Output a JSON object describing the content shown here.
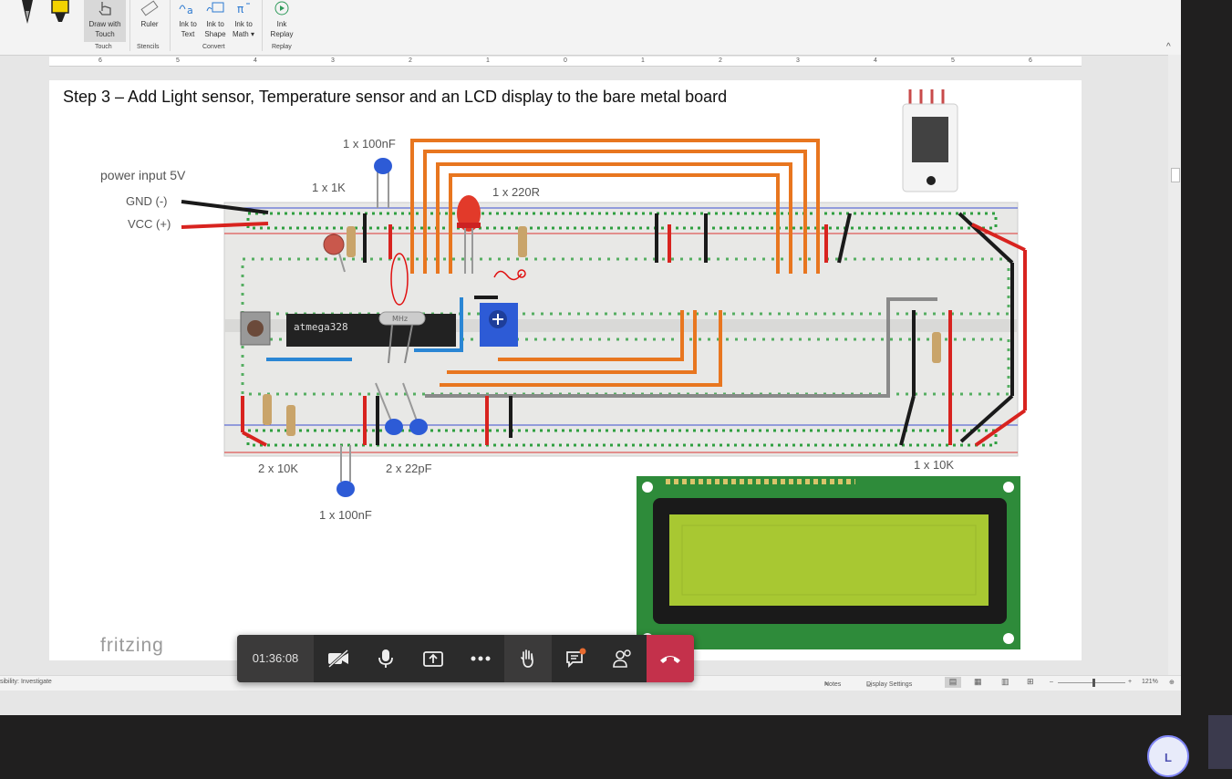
{
  "ribbon": {
    "buttons": [
      {
        "label": "Draw with Touch"
      },
      {
        "label": "Ruler"
      },
      {
        "label": "Ink to Text"
      },
      {
        "label": "Ink to Shape"
      },
      {
        "label": "Ink to Math"
      },
      {
        "label": "Ink Replay"
      }
    ],
    "groups": [
      "Touch",
      "Stencils",
      "Convert",
      "Replay"
    ]
  },
  "ruler": {
    "ticks": [
      "6",
      "5",
      "4",
      "3",
      "2",
      "1",
      "0",
      "1",
      "2",
      "3",
      "4",
      "5",
      "6"
    ]
  },
  "slide": {
    "title": "Step 3 – Add Light sensor, Temperature sensor and an LCD display to the bare metal board",
    "labels": {
      "cap_top": "1 x 100nF",
      "power_input": "power input 5V",
      "gnd": "GND (-)",
      "vcc": "VCC (+)",
      "r1k": "1 x 1K",
      "r220": "1 x 220R",
      "r10k_left": "2 x 10K",
      "caps22": "2 x 22pF",
      "cap_bottom": "1 x 100nF",
      "r10k_right": "1 x 10K",
      "chip": "atmega328",
      "crystal": "MHz"
    },
    "watermark": "fritzing"
  },
  "status": {
    "accessibility": "sibility: Investigate",
    "notes": "Notes",
    "display_settings": "Display Settings",
    "zoom": "121%"
  },
  "call": {
    "timer": "01:36:08",
    "buttons": [
      "camera-off",
      "microphone",
      "share",
      "more",
      "raise-hand",
      "chat",
      "participants",
      "hang-up"
    ]
  },
  "user": {
    "initial": "L"
  },
  "colors": {
    "wire_orange": "#e8761f",
    "wire_red": "#d8231f",
    "wire_black": "#1a1a1a",
    "wire_blue": "#2a86d4",
    "wire_gray": "#8a8a8a",
    "hangup": "#c4314b",
    "lcd_screen": "#a8c832",
    "lcd_board": "#2e8b3a"
  }
}
